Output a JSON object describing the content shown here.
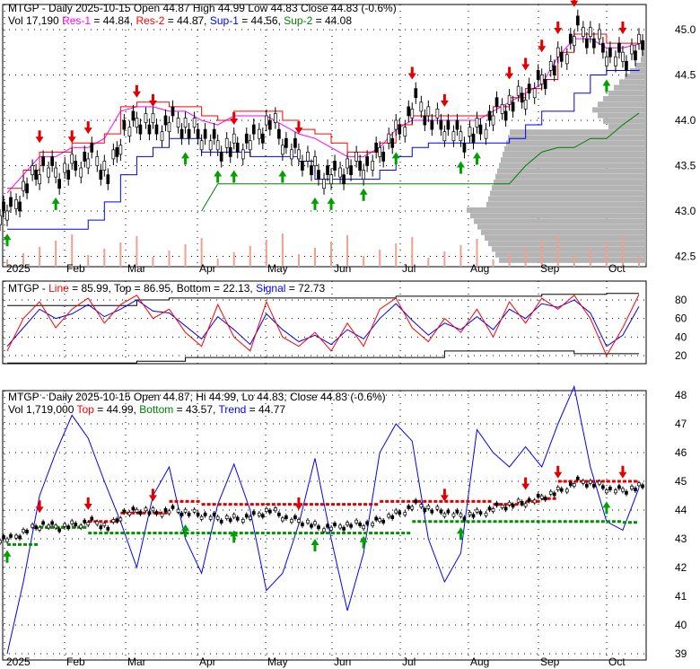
{
  "panel1": {
    "ticker": "MTGP",
    "title": "MTGP - Daily 2025-10-15 Open 44.87  High 44.99  Low 44.83  Close 44.83 (-0.6%)",
    "vol": "Vol 17,190",
    "res1": "Res-1",
    "res1_val": " = 44.84, ",
    "res2": "Res-2",
    "res2_val": " = 44.87, ",
    "sup1": "Sup-1",
    "sup1_val": " = 44.56, ",
    "sup2": "Sup-2",
    "sup2_val": " = 44.08"
  },
  "panel2": {
    "prefix": "MTGP - ",
    "line": "Line",
    "line_val": " = 85.99, Top = 86.95, Bottom = 22.13, ",
    "signal": "Signal",
    "signal_val": " = 72.73"
  },
  "panel3": {
    "title": "MTGP - Daily 2025-10-15 Open 44.87, Hi 44.99, Lo 44.83, Close 44.83 (-0.6%)",
    "vol": "Vol 1,719,000 ",
    "top": "Top",
    "top_val": " = 44.99, ",
    "bottom": "Bottom",
    "bottom_val": " = 43.57, ",
    "trend": "Trend",
    "trend_val": " = 44.77"
  },
  "colors": {
    "res1": "#ff00ff",
    "res2": "#ff0000",
    "sup1": "#0000ff",
    "sup2": "#008000",
    "profile": "#b4b4b4",
    "volume": "#f0a090"
  },
  "chart_data": [
    {
      "type": "candlestick",
      "title": "MTGP - Daily",
      "y_ticks": [
        "45.0",
        "44.5",
        "44.0",
        "43.5",
        "43.0",
        "42.5"
      ],
      "ylim": [
        42.45,
        45.3
      ],
      "x_labels": [
        "2025",
        "Feb",
        "Mar",
        "Apr",
        "May",
        "Jun",
        "Jul",
        "Aug",
        "Sep",
        "Oct"
      ],
      "weekly_close": [
        43.0,
        43.3,
        43.5,
        43.4,
        43.5,
        43.6,
        43.4,
        43.9,
        44.0,
        43.9,
        44.0,
        43.9,
        43.8,
        43.7,
        43.7,
        43.8,
        44.0,
        43.7,
        43.6,
        43.4,
        43.4,
        43.5,
        43.5,
        43.7,
        43.9,
        44.2,
        44.0,
        43.9,
        43.8,
        43.9,
        44.1,
        44.2,
        44.3,
        44.5,
        44.7,
        45.0,
        44.9,
        44.7,
        44.7,
        44.83
      ],
      "res1": [
        43.2,
        43.4,
        43.6,
        43.6,
        43.7,
        43.7,
        43.8,
        44.1,
        44.15,
        44.15,
        44.1,
        44.1,
        44.0,
        43.95,
        44.05,
        44.05,
        44.05,
        43.95,
        43.85,
        43.8,
        43.7,
        43.6,
        43.6,
        43.7,
        43.9,
        44.0,
        44.0,
        44.0,
        44.0,
        44.0,
        44.1,
        44.2,
        44.3,
        44.4,
        44.7,
        44.9,
        44.9,
        44.8,
        44.8,
        44.84
      ],
      "sup1": [
        42.8,
        42.8,
        42.8,
        42.8,
        42.8,
        42.9,
        43.1,
        43.4,
        43.6,
        43.7,
        43.8,
        43.8,
        43.65,
        43.65,
        43.65,
        43.6,
        43.6,
        43.6,
        43.55,
        43.35,
        43.35,
        43.35,
        43.35,
        43.45,
        43.6,
        43.7,
        43.75,
        43.75,
        43.75,
        43.75,
        43.75,
        43.8,
        43.95,
        44.1,
        44.1,
        44.3,
        44.5,
        44.55,
        44.55,
        44.56
      ],
      "sup2": [
        null,
        null,
        null,
        null,
        null,
        null,
        null,
        null,
        null,
        null,
        null,
        null,
        43.0,
        43.3,
        43.3,
        43.3,
        43.3,
        43.3,
        43.3,
        43.3,
        43.3,
        43.3,
        43.3,
        43.3,
        43.3,
        43.3,
        43.3,
        43.3,
        43.3,
        43.3,
        43.3,
        43.3,
        43.5,
        43.65,
        43.7,
        43.7,
        43.8,
        43.8,
        43.95,
        44.08
      ],
      "sell_signals": [
        2,
        4,
        5,
        8,
        9,
        14,
        18,
        25,
        27,
        31,
        32,
        33,
        34,
        35,
        38
      ],
      "buy_signals": [
        0,
        3,
        11,
        13,
        14,
        17,
        19,
        20,
        22,
        24,
        28,
        29,
        37
      ]
    },
    {
      "type": "line",
      "title": "Stochastic",
      "y_ticks": [
        "80",
        "60",
        "40",
        "20"
      ],
      "ylim": [
        10,
        90
      ],
      "line": [
        25,
        60,
        78,
        50,
        70,
        82,
        55,
        75,
        85,
        60,
        70,
        45,
        30,
        75,
        40,
        25,
        78,
        40,
        30,
        45,
        25,
        55,
        30,
        70,
        82,
        50,
        35,
        60,
        45,
        70,
        40,
        78,
        55,
        82,
        70,
        85,
        60,
        20,
        50,
        86
      ],
      "signal": [
        30,
        50,
        70,
        60,
        65,
        75,
        62,
        70,
        80,
        68,
        66,
        52,
        38,
        62,
        48,
        32,
        65,
        48,
        35,
        42,
        32,
        48,
        38,
        60,
        76,
        58,
        42,
        55,
        48,
        62,
        48,
        70,
        60,
        76,
        72,
        80,
        66,
        30,
        42,
        73
      ],
      "top": [
        74,
        74,
        74,
        74,
        74,
        74,
        74,
        74,
        80,
        80,
        82,
        82,
        82,
        82,
        82,
        82,
        82,
        82,
        82,
        82,
        82,
        82,
        82,
        82,
        84,
        84,
        84,
        84,
        84,
        84,
        84,
        84,
        84,
        86,
        86,
        86,
        86,
        87,
        87,
        87
      ],
      "bottom": [
        12,
        12,
        12,
        12,
        12,
        12,
        12,
        12,
        14,
        14,
        14,
        18,
        18,
        18,
        18,
        18,
        18,
        18,
        18,
        18,
        18,
        18,
        18,
        18,
        18,
        18,
        18,
        25,
        25,
        25,
        25,
        25,
        25,
        25,
        25,
        22,
        22,
        22,
        22,
        22
      ]
    },
    {
      "type": "line",
      "title": "Trend",
      "y_ticks": [
        "48",
        "47",
        "46",
        "45",
        "44",
        "43",
        "42",
        "41",
        "40",
        "39"
      ],
      "ylim": [
        38.8,
        48.2
      ],
      "trend": [
        39.0,
        41.5,
        44.5,
        46.0,
        47.3,
        46.5,
        45.0,
        43.6,
        42.0,
        44.5,
        45.5,
        43.0,
        41.8,
        44.2,
        45.6,
        44.0,
        41.2,
        41.8,
        43.5,
        45.8,
        43.0,
        40.5,
        42.5,
        46.0,
        47.0,
        46.4,
        43.0,
        41.5,
        42.5,
        46.8,
        46.0,
        45.5,
        46.2,
        45.5,
        47.0,
        48.3,
        45.5,
        43.6,
        43.3,
        44.77
      ],
      "top": [
        null,
        null,
        43.4,
        43.4,
        43.4,
        43.6,
        43.6,
        43.9,
        43.9,
        43.9,
        44.3,
        44.3,
        44.2,
        44.2,
        44.2,
        44.2,
        44.2,
        44.2,
        44.2,
        44.2,
        44.2,
        44.2,
        44.2,
        44.3,
        44.3,
        44.3,
        44.3,
        44.3,
        44.3,
        44.3,
        44.2,
        44.2,
        44.3,
        44.4,
        45.0,
        45.0,
        45.0,
        45.0,
        45.0,
        44.99
      ],
      "bottom": [
        42.8,
        42.8,
        43.4,
        43.4,
        43.4,
        43.2,
        43.2,
        43.2,
        43.2,
        43.2,
        43.2,
        43.2,
        43.2,
        43.2,
        43.2,
        43.2,
        43.2,
        43.2,
        43.2,
        43.2,
        43.2,
        43.2,
        43.2,
        43.2,
        43.2,
        43.6,
        43.6,
        43.6,
        43.6,
        43.6,
        43.6,
        43.6,
        43.6,
        43.6,
        43.6,
        43.6,
        43.6,
        43.6,
        43.57,
        43.57
      ]
    }
  ]
}
